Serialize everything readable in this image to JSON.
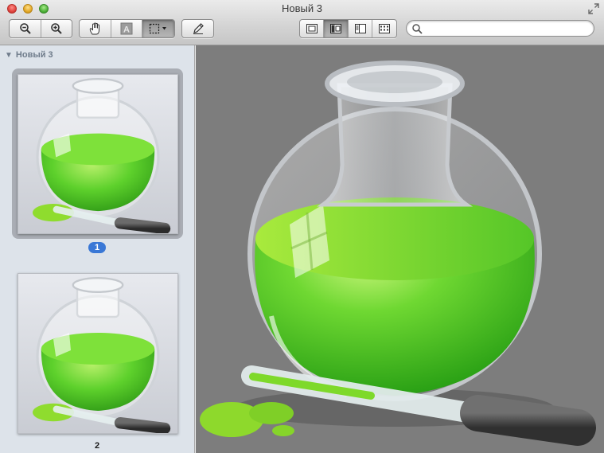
{
  "window": {
    "title": "Новый 3"
  },
  "toolbar": {
    "zoom_out_icon": "zoom-out-icon",
    "zoom_in_icon": "zoom-in-icon",
    "hand_tool_icon": "hand-icon",
    "text_tool_icon": "text-select-icon",
    "rect_select_icon": "rect-select-icon",
    "annotate_icon": "pencil-icon",
    "view_modes": [
      "content-only",
      "thumbnails",
      "table-of-contents",
      "contact-sheet"
    ],
    "active_view": "thumbnails"
  },
  "search": {
    "placeholder": "",
    "value": ""
  },
  "sidebar": {
    "header": "Новый 3",
    "pages": [
      {
        "label": "1",
        "selected": true
      },
      {
        "label": "2",
        "selected": false
      }
    ]
  },
  "colors": {
    "liquid": "#5ed12c",
    "selection_badge": "#3a78d6",
    "canvas_bg": "#7d7d7d",
    "sidebar_bg": "#dde3ea"
  }
}
